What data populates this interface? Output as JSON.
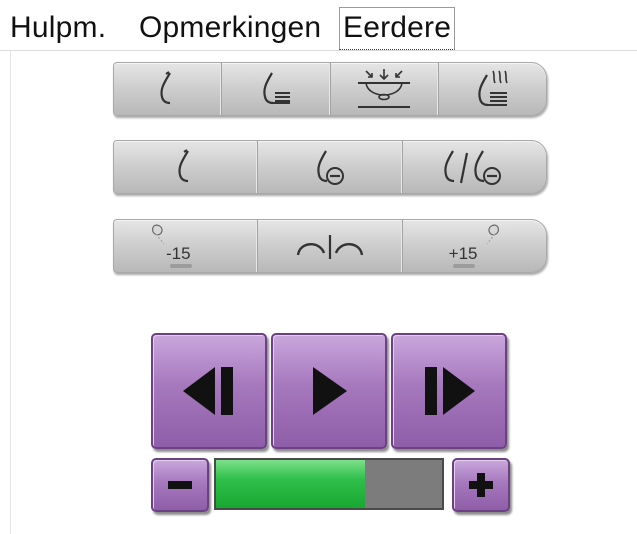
{
  "tabs": [
    {
      "label": "Hulpm.",
      "active": false
    },
    {
      "label": "Opmerkingen",
      "active": false
    },
    {
      "label": "Eerdere",
      "active": true
    }
  ],
  "toolbar_rows": [
    {
      "buttons": [
        "breast-view-icon",
        "breast-lines-icon",
        "compression-icon",
        "breast-heat-icon"
      ]
    },
    {
      "buttons": [
        "breast-view-icon",
        "breast-minus-icon",
        "breast-split-icon"
      ]
    },
    {
      "buttons": [
        "tilt-left-icon",
        "flip-icon",
        "tilt-right-icon"
      ]
    }
  ],
  "tilt": {
    "minus_label": "-15",
    "plus_label": "+15"
  },
  "playback": {
    "buttons": [
      "step-back-icon",
      "play-icon",
      "step-forward-icon"
    ],
    "speed_fraction": 0.66,
    "minus_icon": "minus-icon",
    "plus_icon": "plus-icon"
  },
  "colors": {
    "accent_purple": "#a678bd",
    "progress_green": "#2fbf4a",
    "toolbar_gray": "#cfcfcf"
  }
}
